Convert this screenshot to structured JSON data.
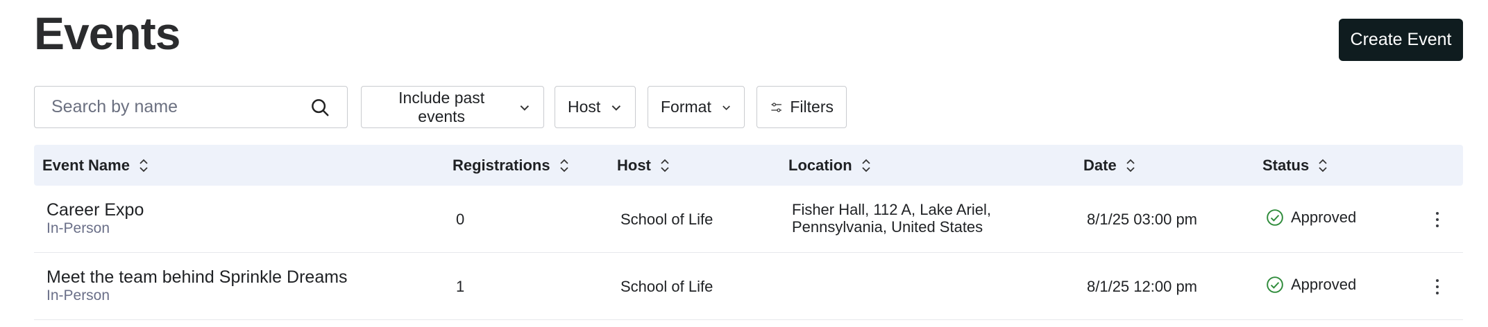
{
  "page": {
    "title": "Events"
  },
  "actions": {
    "create_label": "Create Event"
  },
  "search": {
    "placeholder": "Search by name"
  },
  "filters": {
    "past_events": "Include past events",
    "host": "Host",
    "format": "Format",
    "more": "Filters"
  },
  "table": {
    "columns": {
      "event_name": "Event Name",
      "registrations": "Registrations",
      "host": "Host",
      "location": "Location",
      "date": "Date",
      "status": "Status"
    },
    "rows": [
      {
        "name": "Career Expo",
        "format": "In-Person",
        "registrations": "0",
        "host": "School of Life",
        "location_line1": "Fisher Hall, 112 A, Lake Ariel,",
        "location_line2": "Pennsylvania, United States",
        "date": "8/1/25 03:00 pm",
        "status": "Approved"
      },
      {
        "name": "Meet the team behind Sprinkle Dreams",
        "format": "In-Person",
        "registrations": "1",
        "host": "School of Life",
        "location_line1": "",
        "location_line2": "",
        "date": "8/1/25 12:00 pm",
        "status": "Approved"
      }
    ]
  },
  "colors": {
    "primary_button": "#0f1c1f",
    "header_bg": "#eef2fa",
    "status_ok": "#2e8b3a",
    "subtext": "#6a6f88"
  }
}
